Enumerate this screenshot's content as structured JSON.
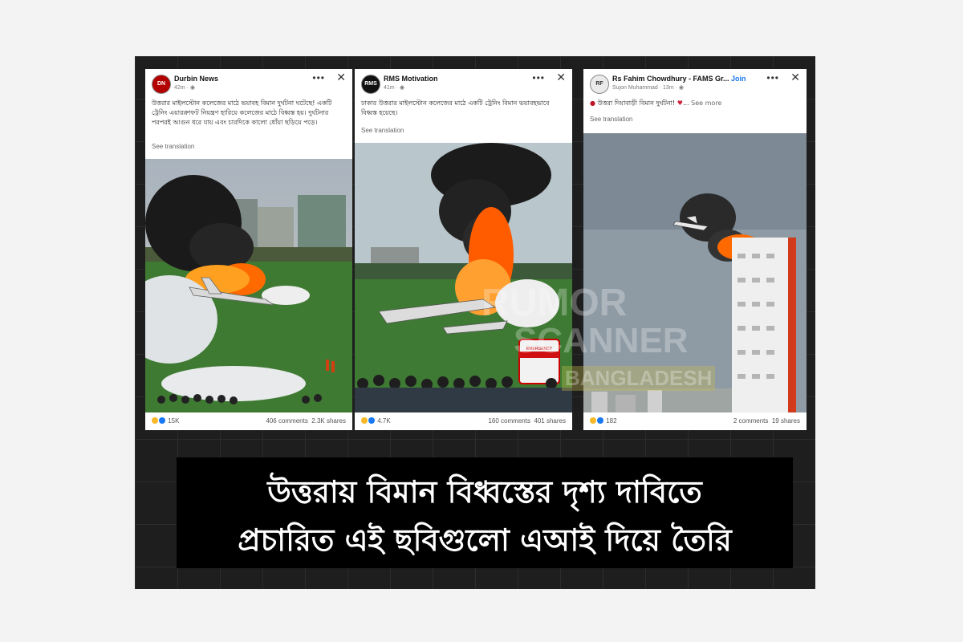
{
  "posts": [
    {
      "name": "Durbin News",
      "meta": "42m · ◉",
      "avatar_text": "DN",
      "text": "উত্তরার মাইলস্টোন কলেজের মাঠে ভয়াবহ বিমান দুর্ঘটনা ঘটেছে! একটি ট্রেনিং এয়ারক্রাফট নিয়ন্ত্রণ হারিয়ে কলেজের মাঠে বিধ্বস্ত হয়। দুর্ঘটনার পরপরই আগুন ধরে যায় এবং চারদিকে কালো ধোঁয়া ছড়িয়ে পড়ে।",
      "see_translation": "See translation",
      "reactions": "15K",
      "comments": "406 comments",
      "shares": "2.3K shares"
    },
    {
      "name": "RMS Motivation",
      "meta": "41m · ◉",
      "avatar_text": "RMS",
      "text": "ঢাকার উত্তরার মাইলস্টোন কলেজের মাঠে একটি ট্রেনিং বিমান ভয়াবহভাবে বিধ্বস্ত হয়েছে।",
      "see_translation": "See translation",
      "reactions": "4.7K",
      "comments": "160 comments",
      "shares": "401 shares",
      "ambulance_text": "EMERGENCY"
    },
    {
      "name": "Rs Fahim Chowdhury - FAMS Gr...",
      "join": "Join",
      "meta": "Sujon Muhammad · 13m · ◉",
      "avatar_text": "RF",
      "text": "উত্তরা দিয়াবাড়ী বিমান দুর্ঘটনা!",
      "see_more": "See more",
      "see_translation": "See translation",
      "reactions": "182",
      "comments": "2 comments",
      "shares": "19 shares"
    }
  ],
  "ui": {
    "dots": "•••",
    "close": "✕"
  },
  "watermark": {
    "line1": "RUMOR",
    "line2": "SCANNER",
    "line3": "BANGLADESH"
  },
  "caption": {
    "line1": "উত্তরায় বিমান বিধ্বস্তের দৃশ্য দাবিতে",
    "line2": "প্রচারিত এই ছবিগুলো এআই দিয়ে তৈরি"
  },
  "colors": {
    "background": "#f3f3f3",
    "board": "#1e1e1e",
    "caption_bg": "#000000",
    "link": "#1877f2",
    "fire": "#ff6a00"
  }
}
